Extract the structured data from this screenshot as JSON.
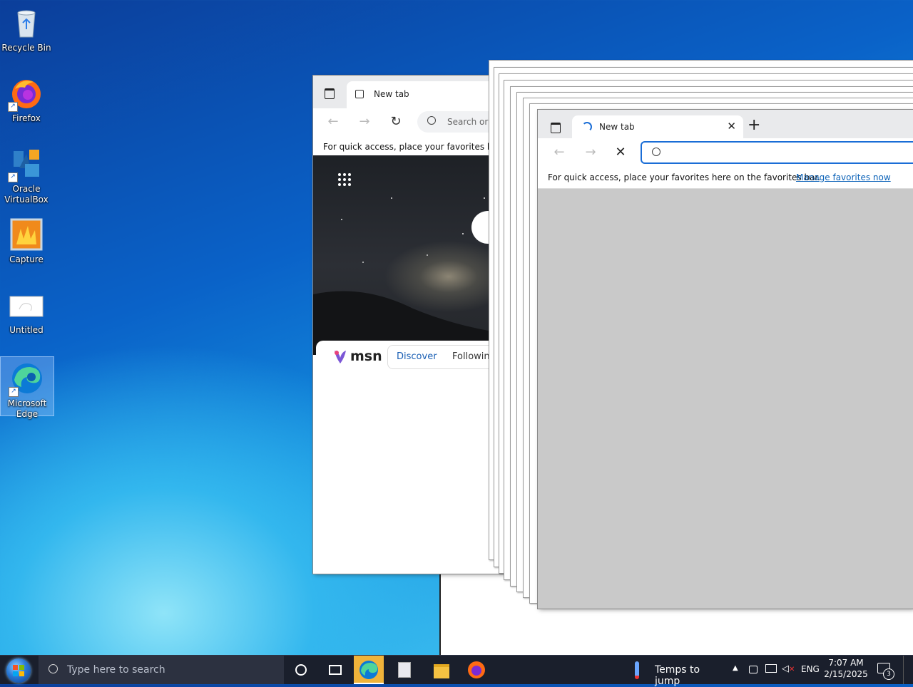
{
  "desktop_icons": [
    {
      "label": "Recycle Bin",
      "icon": "recycle-bin-icon"
    },
    {
      "label": "Firefox",
      "icon": "firefox-icon"
    },
    {
      "label": "Oracle VirtualBox",
      "icon": "virtualbox-icon"
    },
    {
      "label": "Capture",
      "icon": "capture-icon"
    },
    {
      "label": "Untitled",
      "icon": "untitled-document-icon"
    },
    {
      "label": "Microsoft Edge",
      "icon": "edge-icon"
    }
  ],
  "back_window": {
    "tab_title": "New tab",
    "search_placeholder": "Search or",
    "favorites_hint": "For quick access, place your favorites here",
    "msn_logo": "msn",
    "feed_tabs": [
      "Discover",
      "Followin"
    ]
  },
  "front_window": {
    "tab_title": "New tab",
    "favorites_hint": "For quick access, place your favorites here on the favorites bar.",
    "manage_favorites": "Manage favorites now",
    "address_value": ""
  },
  "taskbar": {
    "search_placeholder": "Type here to search",
    "weather_text": "Temps to jump",
    "language": "ENG",
    "time": "7:07 AM",
    "date": "2/15/2025",
    "notification_count": "3"
  },
  "colors": {
    "accent": "#0067c0",
    "taskbar_bg": "#1a1f2c",
    "link": "#0b62b8"
  }
}
